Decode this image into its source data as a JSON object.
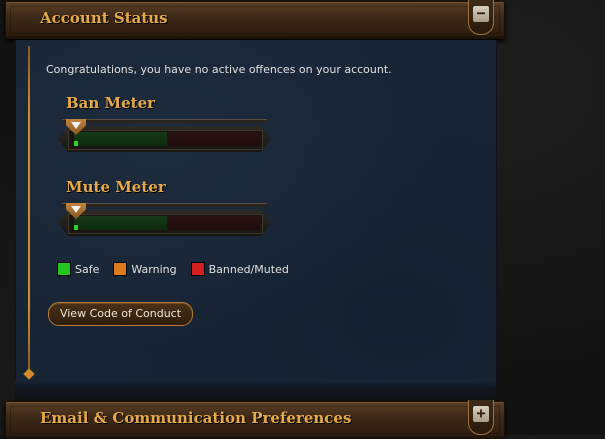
{
  "account_status": {
    "title": "Account Status",
    "toggle_symbol": "−",
    "message": "Congratulations, you have no active offences on your account.",
    "ban_meter": {
      "title": "Ban Meter",
      "level_fraction": 0.0
    },
    "mute_meter": {
      "title": "Mute Meter",
      "level_fraction": 0.0
    },
    "legend": [
      {
        "label": "Safe",
        "color": "#22c41e"
      },
      {
        "label": "Warning",
        "color": "#d97a1c"
      },
      {
        "label": "Banned/Muted",
        "color": "#d42020"
      }
    ],
    "code_of_conduct_button": "View Code of Conduct"
  },
  "email_prefs": {
    "title": "Email & Communication Preferences",
    "toggle_symbol": "+"
  },
  "colors": {
    "accent_gold": "#e6a94a",
    "panel_bg": "#172434",
    "wood": "#3b2716"
  }
}
